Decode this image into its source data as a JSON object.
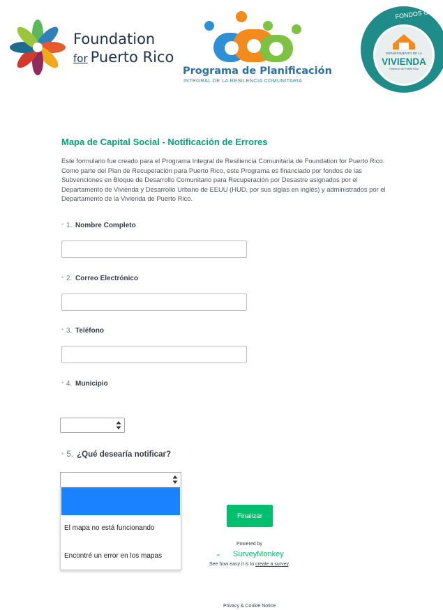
{
  "header": {
    "fpr_line1": "Foundation",
    "fpr_for": "for",
    "fpr_line2": "Puerto Rico",
    "ppi_title": "Programa de Planificación",
    "ppi_subtitle": "INTEGRAL DE LA RESILENCIA COMUNITARIA",
    "badge_top": "FONDOS CDBG-DR",
    "badge_dept": "DEPARTAMENTO DE LA",
    "badge_vivienda": "VIVIENDA",
    "badge_gov": "Gobierno de Puerto Rico"
  },
  "survey": {
    "title": "Mapa de Capital Social - Notificación de Errores",
    "intro": "Este formulario fue creado para el Programa Integral de Resiliencia Comunitaria de Foundation for Puerto Rico.  Como parte del Plan de Recuperación para Puerto Rico, este Programa es financiado por fondos de las Subvenciones en Bloque de Desarrollo Comunitario para Recuperación por Desastre asignados por el Departamento de Vivienda y Desarrollo Urbano de EEUU (HUD, por sus siglas en inglés) y administrados por el Departamento de la Vivienda de Puerto Rico.",
    "questions": [
      {
        "req": "*",
        "num": "1.",
        "label": "Nombre Completo"
      },
      {
        "req": "*",
        "num": "2.",
        "label": "Correo Electrónico"
      },
      {
        "req": "*",
        "num": "3.",
        "label": "Teléfono"
      },
      {
        "req": "*",
        "num": "4.",
        "label": "Municipio"
      },
      {
        "req": "*",
        "num": "5.",
        "label": "¿Qué desearía notificar?"
      }
    ],
    "dropdown_options": [
      "",
      "El mapa no está funcionando",
      "Encontré un error en los mapas"
    ],
    "finish_label": "Finalizar"
  },
  "footer": {
    "powered_by": "Powered by",
    "brand": "SurveyMonkey",
    "easy_prefix": "See how easy it is to ",
    "easy_link": "create a survey",
    "easy_suffix": ".",
    "privacy": "Privacy & Cookie Notice"
  },
  "colors": {
    "accent": "#00a37a",
    "button": "#00bf6f",
    "highlight": "#1a81ff",
    "badge": "#1f8c8a"
  }
}
